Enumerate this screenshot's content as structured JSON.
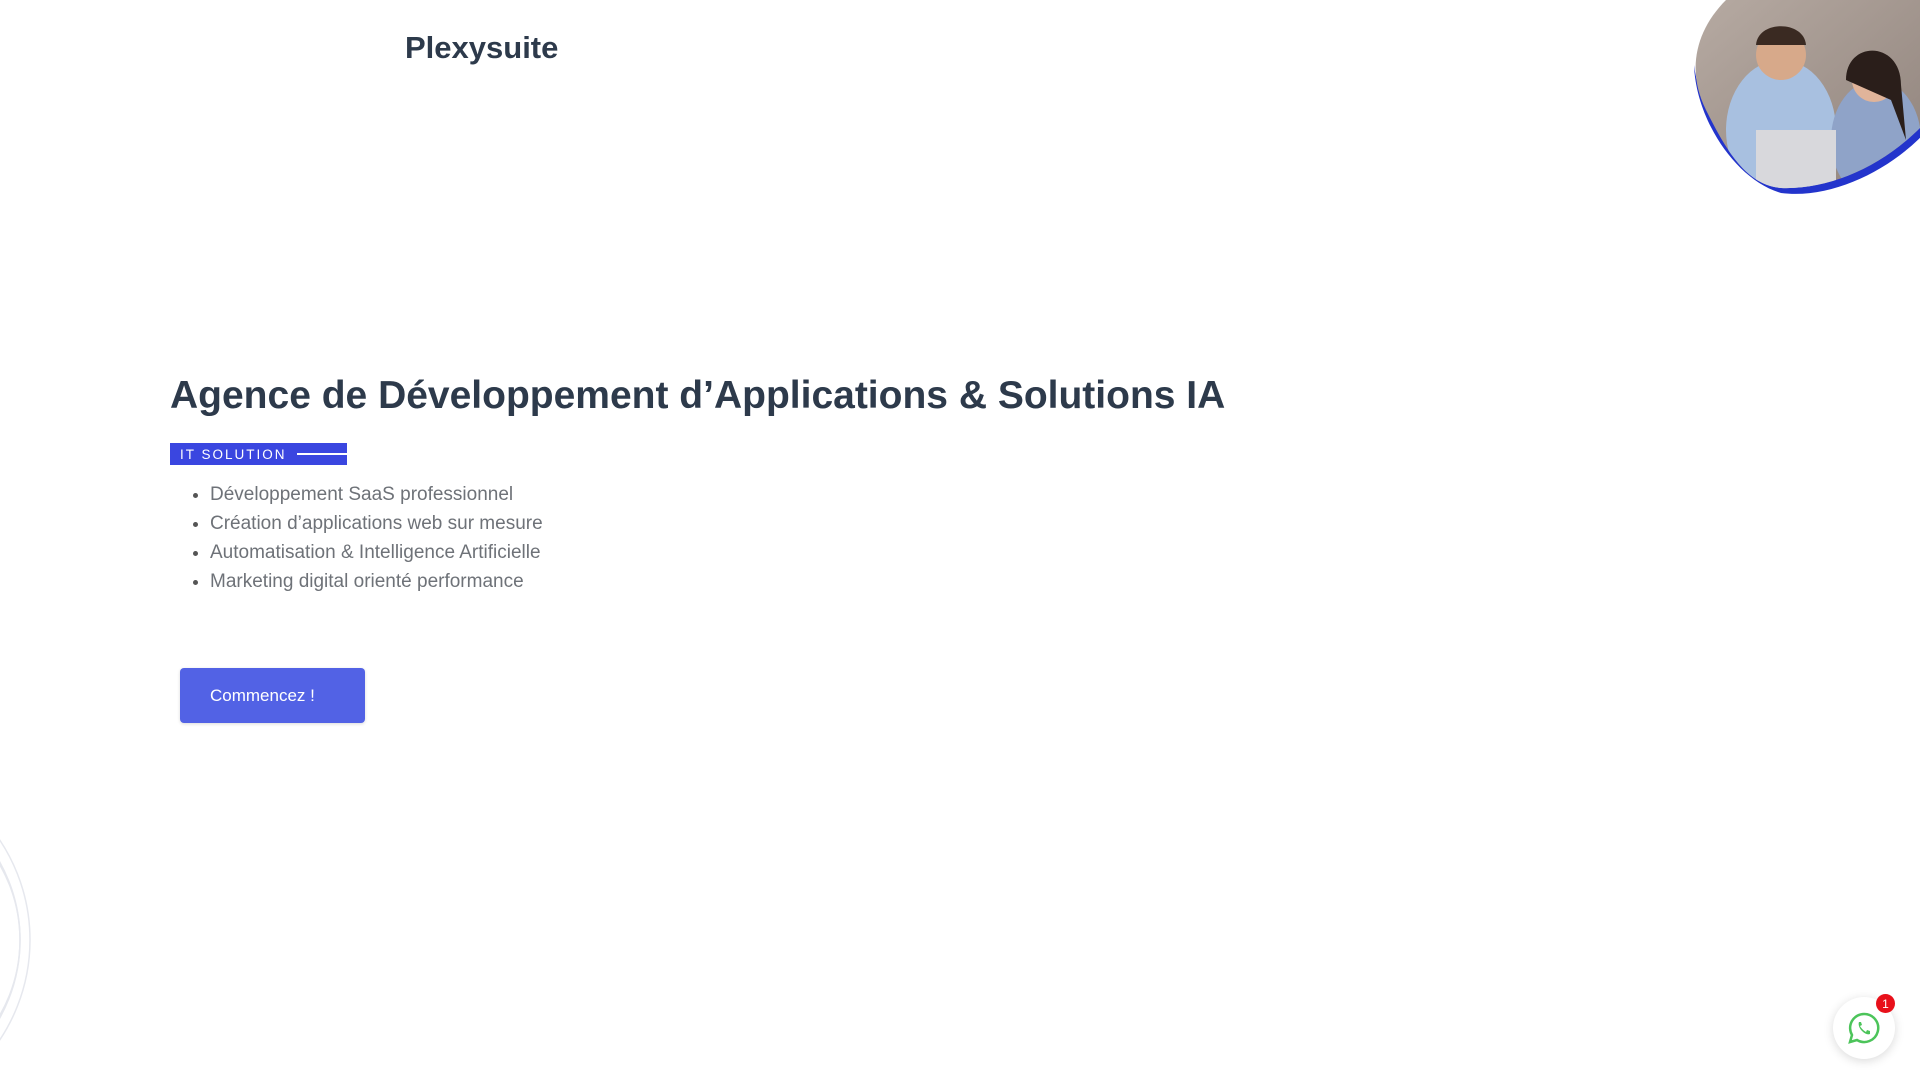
{
  "header": {
    "logo_text": "Plexysuite"
  },
  "hero": {
    "title": "Agence de Développement d’Applications & Solutions IA",
    "tag": "IT SOLUTION",
    "features": [
      "Développement SaaS professionnel",
      "Création d’applications web sur mesure",
      "Automatisation & Intelligence Artificielle",
      "Marketing digital orienté performance"
    ],
    "cta_label": "Commencez !"
  },
  "whatsapp": {
    "badge_count": "1"
  },
  "colors": {
    "accent": "#3a46e0",
    "button": "#5262e5",
    "heading": "#2d3a4b",
    "whatsapp": "#4cc45a",
    "badge": "#e8101a"
  }
}
